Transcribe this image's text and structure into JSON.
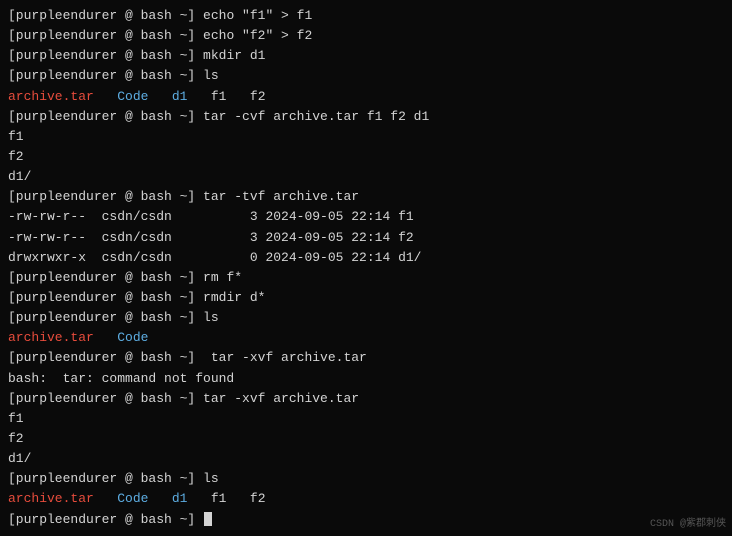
{
  "terminal": {
    "lines": [
      {
        "type": "prompt_cmd",
        "user": "[purpleendurer @ bash ~]",
        "cmd": " echo \"f1\" > f1"
      },
      {
        "type": "prompt_cmd",
        "user": "[purpleendurer @ bash ~]",
        "cmd": " echo \"f2\" > f2"
      },
      {
        "type": "prompt_cmd",
        "user": "[purpleendurer @ bash ~]",
        "cmd": " mkdir d1"
      },
      {
        "type": "prompt_cmd",
        "user": "[purpleendurer @ bash ~]",
        "cmd": " ls"
      },
      {
        "type": "ls_output",
        "content": "archive.tar   Code   d1   f1   f2"
      },
      {
        "type": "prompt_cmd",
        "user": "[purpleendurer @ bash ~]",
        "cmd": " tar -cvf archive.tar f1 f2 d1"
      },
      {
        "type": "plain",
        "content": "f1"
      },
      {
        "type": "plain",
        "content": "f2"
      },
      {
        "type": "plain",
        "content": "d1/"
      },
      {
        "type": "prompt_cmd",
        "user": "[purpleendurer @ bash ~]",
        "cmd": " tar -tvf archive.tar"
      },
      {
        "type": "plain",
        "content": "-rw-rw-r--  csdn/csdn          3 2024-09-05 22:14 f1"
      },
      {
        "type": "plain",
        "content": "-rw-rw-r--  csdn/csdn          3 2024-09-05 22:14 f2"
      },
      {
        "type": "plain",
        "content": "drwxrwxr-x  csdn/csdn          0 2024-09-05 22:14 d1/"
      },
      {
        "type": "prompt_cmd",
        "user": "[purpleendurer @ bash ~]",
        "cmd": " rm f*"
      },
      {
        "type": "prompt_cmd",
        "user": "[purpleendurer @ bash ~]",
        "cmd": " rmdir d*"
      },
      {
        "type": "prompt_cmd",
        "user": "[purpleendurer @ bash ~]",
        "cmd": " ls"
      },
      {
        "type": "ls_output2",
        "content": "archive.tar   Code"
      },
      {
        "type": "prompt_cmd",
        "user": "[purpleendurer @ bash ~]",
        "cmd": "  tar -xvf archive.tar"
      },
      {
        "type": "error",
        "content": "bash:  tar: command not found"
      },
      {
        "type": "prompt_cmd",
        "user": "[purpleendurer @ bash ~]",
        "cmd": " tar -xvf archive.tar"
      },
      {
        "type": "plain",
        "content": "f1"
      },
      {
        "type": "plain",
        "content": "f2"
      },
      {
        "type": "plain",
        "content": "d1/"
      },
      {
        "type": "prompt_cmd",
        "user": "[purpleendurer @ bash ~]",
        "cmd": " ls"
      },
      {
        "type": "ls_output3",
        "content": "archive.tar   Code   d1   f1   f2"
      },
      {
        "type": "prompt_cursor",
        "user": "[purpleendurer @ bash ~]",
        "cmd": " "
      }
    ],
    "watermark": "CSDN @紫郡刺侠"
  }
}
